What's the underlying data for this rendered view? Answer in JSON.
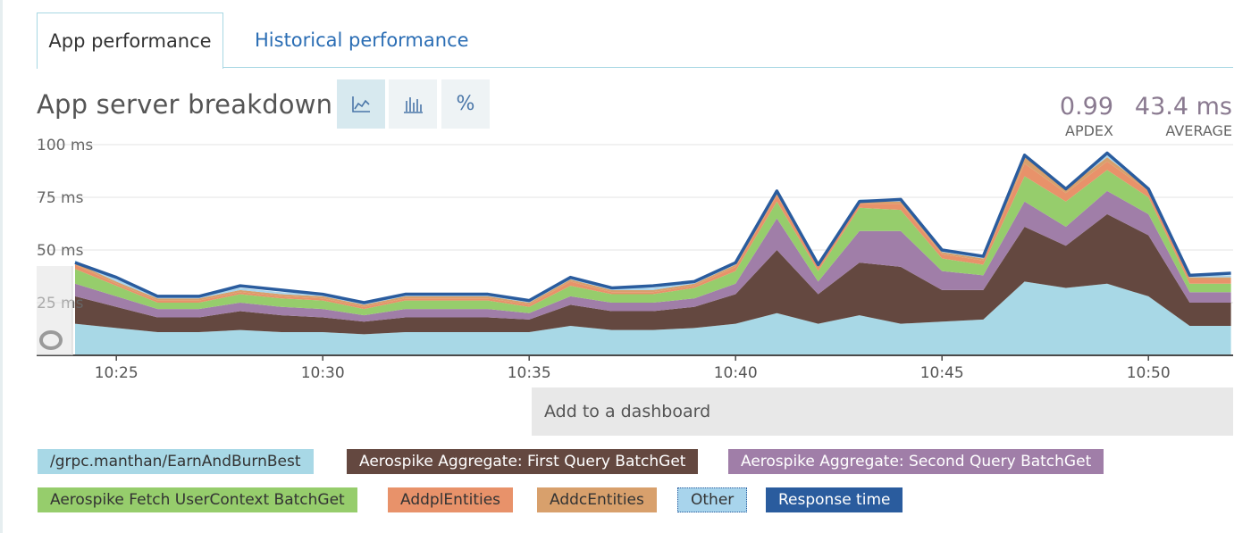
{
  "tabs": {
    "app_performance": "App performance",
    "historical_performance": "Historical performance"
  },
  "header": {
    "title": "App server breakdown",
    "percent_label": "%",
    "apdex_value": "0.99",
    "apdex_label": "APDEX",
    "average_value": "43.4 ms",
    "average_label": "AVERAGE"
  },
  "actions": {
    "add_to_dashboard": "Add to a dashboard"
  },
  "legend": [
    {
      "label": "/grpc.manthan/EarnAndBurnBest",
      "color": "#a8d8e6",
      "text": "#333333"
    },
    {
      "label": "Aerospike Aggregate: First Query BatchGet",
      "color": "#644840",
      "text": "#ffffff"
    },
    {
      "label": "Aerospike Aggregate: Second Query BatchGet",
      "color": "#a07ea8",
      "text": "#ffffff"
    },
    {
      "label": "Aerospike Fetch UserContext BatchGet",
      "color": "#96cd6c",
      "text": "#333333"
    },
    {
      "label": "AddplEntities",
      "color": "#e8926a",
      "text": "#333333"
    },
    {
      "label": "AddcEntities",
      "color": "#d8a06c",
      "text": "#333333"
    },
    {
      "label": "Other",
      "color": "#a8d4ec",
      "text": "#333333"
    },
    {
      "label": "Response time",
      "color": "#2a5c9e",
      "text": "#ffffff"
    }
  ],
  "chart_data": {
    "type": "area",
    "x": [
      "10:24",
      "10:25",
      "10:26",
      "10:27",
      "10:28",
      "10:29",
      "10:30",
      "10:31",
      "10:32",
      "10:33",
      "10:34",
      "10:35",
      "10:36",
      "10:37",
      "10:38",
      "10:39",
      "10:40",
      "10:41",
      "10:42",
      "10:43",
      "10:44",
      "10:45",
      "10:46",
      "10:47",
      "10:48",
      "10:49",
      "10:50",
      "10:51",
      "10:52"
    ],
    "x_ticks": [
      "10:25",
      "10:30",
      "10:35",
      "10:40",
      "10:45",
      "10:50"
    ],
    "y_ticks": [
      "100 ms",
      "75 ms",
      "50 ms",
      "25 ms"
    ],
    "ylim": [
      0,
      100
    ],
    "stacked": true,
    "series": [
      {
        "name": "/grpc.manthan/EarnAndBurnBest",
        "color": "#a8d8e6",
        "values": [
          15,
          13,
          11,
          11,
          12,
          11,
          11,
          10,
          11,
          11,
          11,
          11,
          14,
          12,
          12,
          13,
          15,
          20,
          15,
          19,
          15,
          16,
          17,
          35,
          32,
          34,
          28,
          14,
          14
        ]
      },
      {
        "name": "Aerospike Aggregate: First Query BatchGet",
        "color": "#644840",
        "values": [
          13,
          10,
          7,
          7,
          9,
          8,
          7,
          6,
          7,
          7,
          7,
          6,
          10,
          9,
          9,
          10,
          14,
          30,
          14,
          25,
          27,
          15,
          14,
          26,
          20,
          33,
          29,
          11,
          11
        ]
      },
      {
        "name": "Aerospike Aggregate: Second Query BatchGet",
        "color": "#a07ea8",
        "values": [
          6,
          5,
          4,
          4,
          4,
          4,
          4,
          3,
          4,
          4,
          4,
          3,
          4,
          4,
          4,
          4,
          5,
          15,
          6,
          15,
          17,
          9,
          7,
          12,
          9,
          11,
          10,
          5,
          5
        ]
      },
      {
        "name": "Aerospike Fetch UserContext BatchGet",
        "color": "#96cd6c",
        "values": [
          7,
          5,
          3,
          3,
          4,
          4,
          4,
          3,
          4,
          4,
          4,
          3,
          5,
          4,
          4,
          5,
          6,
          8,
          5,
          11,
          10,
          6,
          5,
          12,
          12,
          10,
          8,
          4,
          4
        ]
      },
      {
        "name": "AddplEntities",
        "color": "#e8926a",
        "values": [
          2,
          1,
          1,
          1,
          1,
          1,
          1,
          1,
          1,
          1,
          1,
          1,
          2,
          1,
          1,
          1,
          2,
          3,
          2,
          2,
          3,
          2,
          2,
          6,
          4,
          4,
          3,
          2,
          2
        ]
      },
      {
        "name": "AddcEntities",
        "color": "#d8a06c",
        "values": [
          1,
          1,
          1,
          1,
          1,
          1,
          1,
          1,
          1,
          1,
          1,
          1,
          1,
          1,
          1,
          1,
          1,
          1,
          1,
          1,
          1,
          1,
          1,
          3,
          2,
          2,
          1,
          1,
          1
        ]
      },
      {
        "name": "Other",
        "color": "#a8d4ec",
        "values": [
          1,
          1,
          1,
          1,
          1,
          1,
          1,
          1,
          1,
          1,
          1,
          1,
          1,
          1,
          1,
          1,
          1,
          1,
          1,
          1,
          1,
          1,
          1,
          1,
          1,
          1,
          1,
          1,
          1
        ]
      }
    ],
    "line": {
      "name": "Response time",
      "color": "#2a5c9e",
      "values": [
        44,
        37,
        28,
        28,
        33,
        31,
        29,
        25,
        29,
        29,
        29,
        26,
        37,
        32,
        33,
        35,
        44,
        78,
        43,
        73,
        74,
        50,
        47,
        95,
        79,
        96,
        79,
        38,
        39
      ]
    },
    "grid": true
  }
}
